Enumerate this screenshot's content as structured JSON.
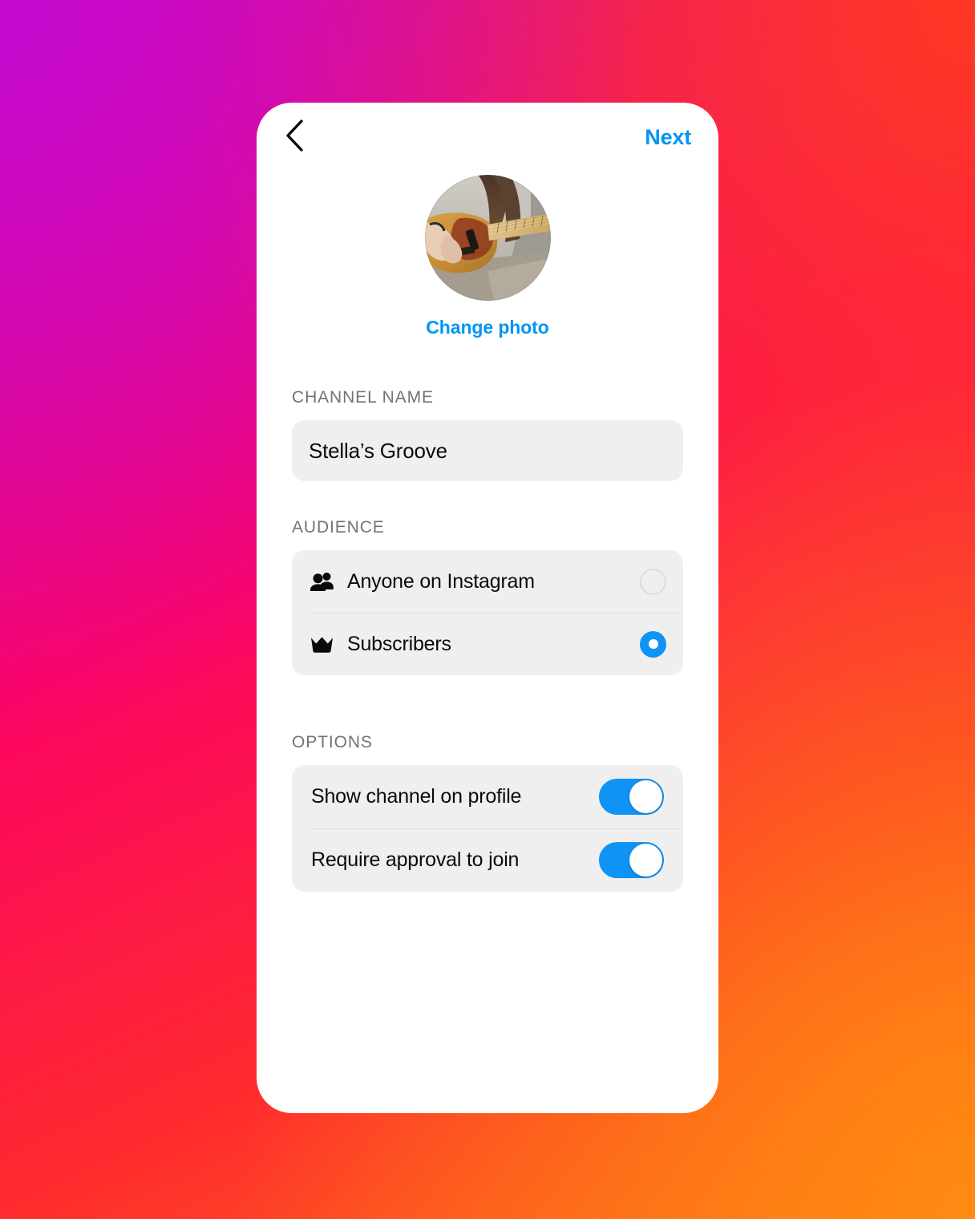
{
  "background": {
    "gradient_colors": [
      "#C408CE",
      "#D40BA8",
      "#FB0463",
      "#FF3822",
      "#FD7216"
    ]
  },
  "theme": {
    "accent_blue": "#0095F6",
    "toggle_blue": "#0F93F4",
    "field_bg": "#EFEFEF",
    "label_gray": "#737373",
    "divider": "#DEDEDE"
  },
  "topbar": {
    "back_icon": "chevron-left-icon",
    "next_label": "Next"
  },
  "avatar": {
    "icon": "avatar-photo",
    "description": "Person playing an electric guitar",
    "change_photo_label": "Change photo"
  },
  "channel_name": {
    "section_label": "CHANNEL NAME",
    "value": "Stella’s Groove",
    "placeholder": "Channel name"
  },
  "audience": {
    "section_label": "AUDIENCE",
    "options": [
      {
        "label": "Anyone on Instagram",
        "icon": "people-icon",
        "selected": false
      },
      {
        "label": "Subscribers",
        "icon": "crown-icon",
        "selected": true
      }
    ]
  },
  "options": {
    "section_label": "OPTIONS",
    "items": [
      {
        "label": "Show channel on profile",
        "enabled": true
      },
      {
        "label": "Require approval to join",
        "enabled": true
      }
    ]
  }
}
